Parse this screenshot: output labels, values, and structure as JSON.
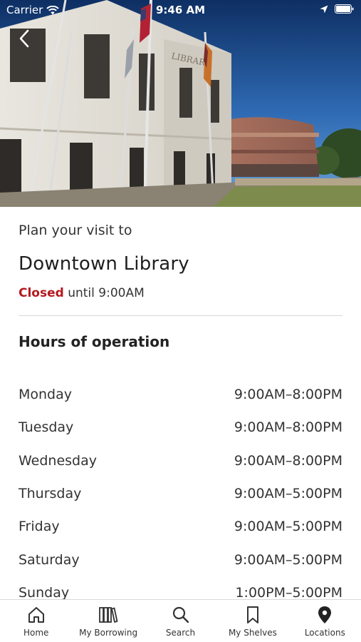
{
  "status_bar": {
    "carrier": "Carrier",
    "time": "9:46 AM"
  },
  "hero": {
    "building_sign": "LIBRARY"
  },
  "header": {
    "back_icon": "chevron-left-icon"
  },
  "details": {
    "plan_visit_label": "Plan your visit to",
    "library_name": "Downtown Library",
    "status_closed": "Closed",
    "status_until": "until 9:00AM",
    "status_color": "#b3191f"
  },
  "hours": {
    "title": "Hours of operation",
    "rows": [
      {
        "day": "Monday",
        "time": "9:00AM–8:00PM"
      },
      {
        "day": "Tuesday",
        "time": "9:00AM–8:00PM"
      },
      {
        "day": "Wednesday",
        "time": "9:00AM–8:00PM"
      },
      {
        "day": "Thursday",
        "time": "9:00AM–5:00PM"
      },
      {
        "day": "Friday",
        "time": "9:00AM–5:00PM"
      },
      {
        "day": "Saturday",
        "time": "9:00AM–5:00PM"
      },
      {
        "day": "Sunday",
        "time": "1:00PM–5:00PM"
      }
    ]
  },
  "tab_bar": {
    "items": [
      {
        "label": "Home",
        "icon": "home-icon"
      },
      {
        "label": "My Borrowing",
        "icon": "books-icon"
      },
      {
        "label": "Search",
        "icon": "search-icon"
      },
      {
        "label": "My Shelves",
        "icon": "bookmark-icon"
      },
      {
        "label": "Locations",
        "icon": "map-pin-icon"
      }
    ],
    "active": "Locations"
  }
}
